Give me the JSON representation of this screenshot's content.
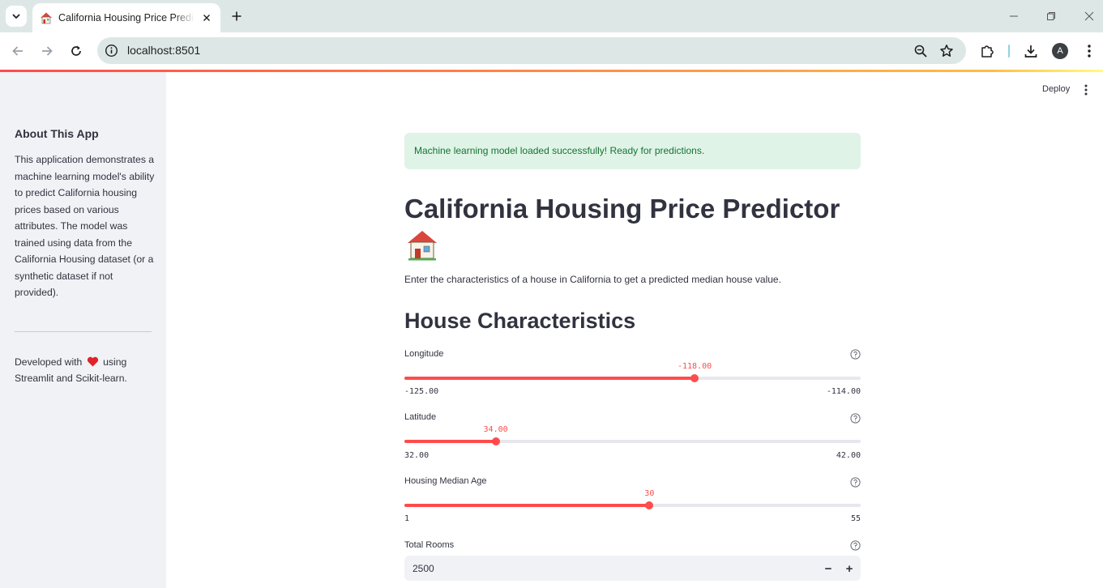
{
  "browser": {
    "tab_title": "California Housing Price Predictor",
    "url": "localhost:8501",
    "avatar_letter": "A"
  },
  "header": {
    "deploy_label": "Deploy"
  },
  "sidebar": {
    "title": "About This App",
    "description": "This application demonstrates a machine learning model's ability to predict California housing prices based on various attributes. The model was trained using data from the California Housing dataset (or a synthetic dataset if not provided).",
    "footer_prefix": "Developed with",
    "footer_suffix": "using Streamlit and Scikit-learn."
  },
  "main": {
    "success_message": "Machine learning model loaded successfully! Ready for predictions.",
    "title": "California Housing Price Predictor",
    "subtitle": "Enter the characteristics of a house in California to get a predicted median house value.",
    "section_heading": "House Characteristics",
    "sliders": [
      {
        "label": "Longitude",
        "value": "-118.00",
        "min": "-125.00",
        "max": "-114.00",
        "fraction": 0.636
      },
      {
        "label": "Latitude",
        "value": "34.00",
        "min": "32.00",
        "max": "42.00",
        "fraction": 0.2
      },
      {
        "label": "Housing Median Age",
        "value": "30",
        "min": "1",
        "max": "55",
        "fraction": 0.537
      }
    ],
    "total_rooms": {
      "label": "Total Rooms",
      "value": "2500",
      "minus": "−",
      "plus": "+"
    }
  },
  "colors": {
    "accent": "#ff4b4b",
    "success_bg": "#dff4e7",
    "success_text": "#177233",
    "sidebar_bg": "#f0f2f6"
  }
}
